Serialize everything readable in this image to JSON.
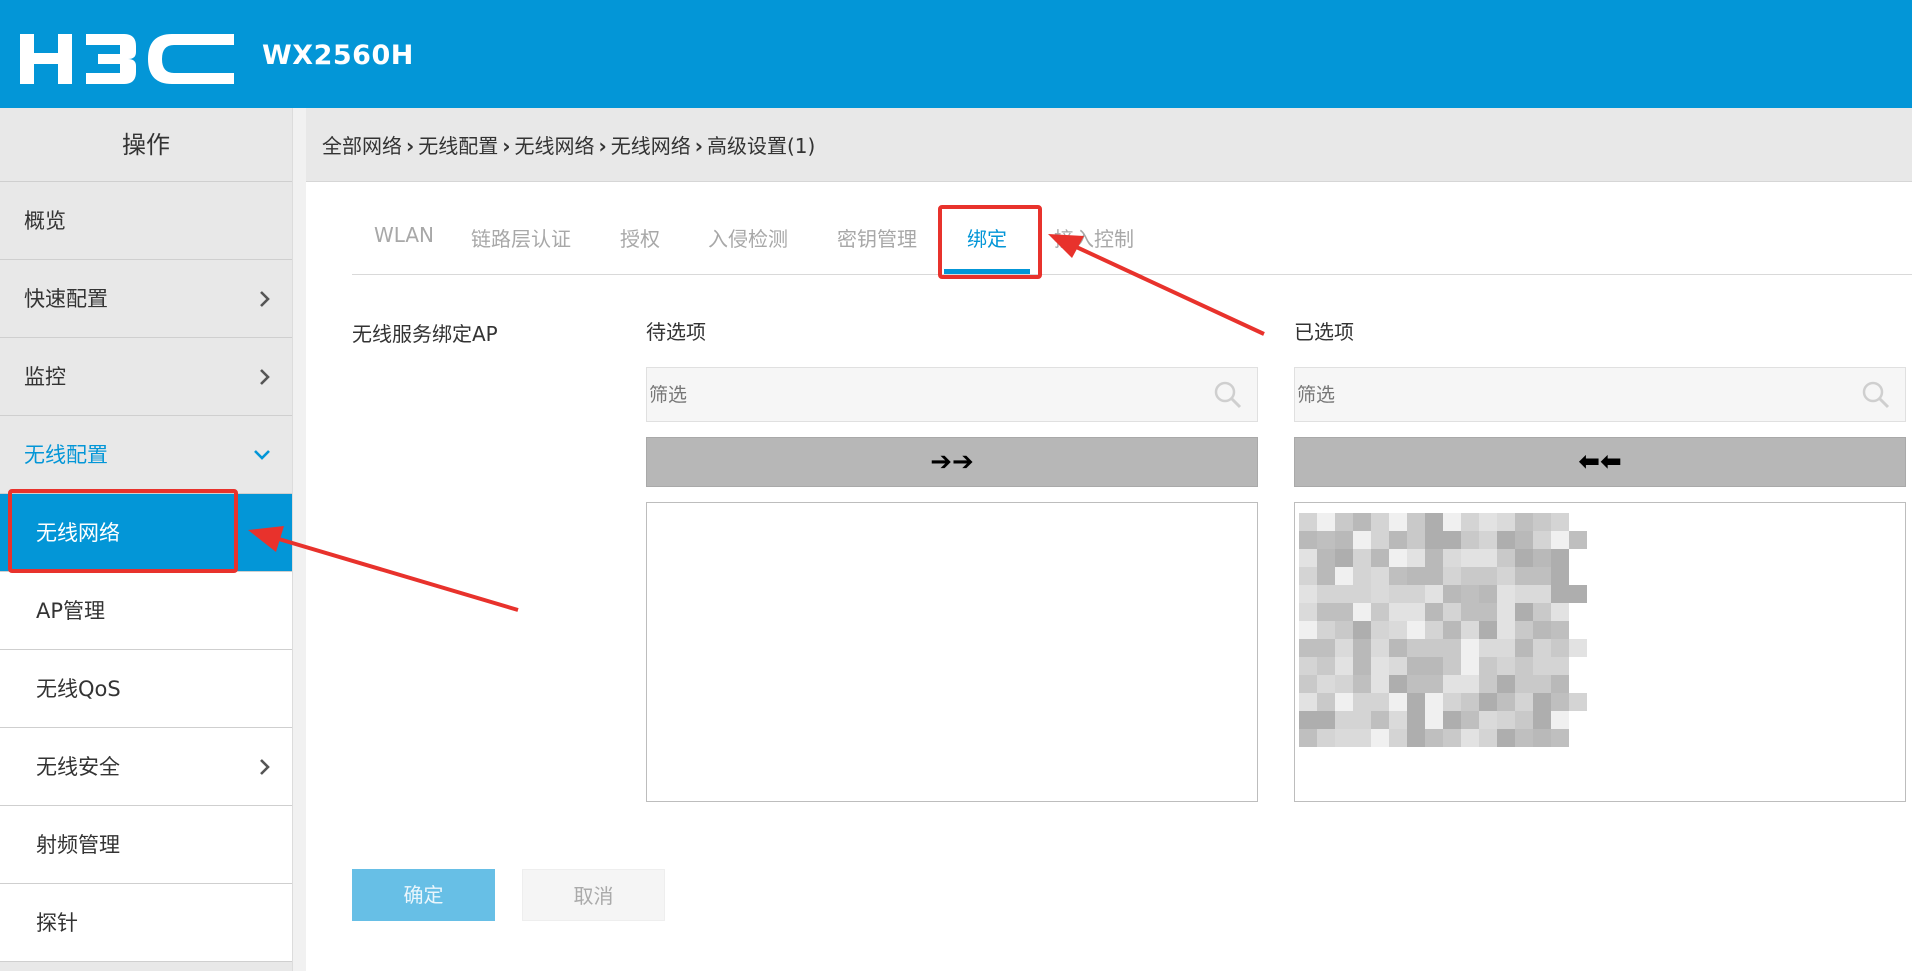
{
  "header": {
    "brand": "H3C",
    "model": "WX2560H",
    "bar_color": "#0396d7"
  },
  "sidebar": {
    "title": "操作",
    "items": [
      {
        "label": "概览",
        "chevron": "",
        "state": "normal"
      },
      {
        "label": "快速配置",
        "chevron": "›",
        "state": "normal"
      },
      {
        "label": "监控",
        "chevron": "›",
        "state": "normal"
      },
      {
        "label": "无线配置",
        "chevron": "⌄",
        "state": "expanded"
      },
      {
        "label": "无线网络",
        "chevron": "",
        "state": "active"
      },
      {
        "label": "AP管理",
        "chevron": "",
        "state": "sub"
      },
      {
        "label": "无线QoS",
        "chevron": "",
        "state": "sub"
      },
      {
        "label": "无线安全",
        "chevron": "›",
        "state": "sub"
      },
      {
        "label": "射频管理",
        "chevron": "",
        "state": "sub"
      },
      {
        "label": "探针",
        "chevron": "",
        "state": "sub"
      }
    ]
  },
  "breadcrumb": [
    "全部网络",
    "无线配置",
    "无线网络",
    "无线网络",
    "高级设置(1)"
  ],
  "tabs": [
    "WLAN",
    "链路层认证",
    "授权",
    "入侵检测",
    "密钥管理",
    "绑定",
    "接入控制"
  ],
  "active_tab": "绑定",
  "binding": {
    "label": "无线服务绑定AP",
    "available": {
      "title": "待选项",
      "filter_placeholder": "筛选",
      "move_label": "➔➔"
    },
    "selected": {
      "title": "已选项",
      "filter_placeholder": "筛选",
      "move_label": "⬅⬅"
    }
  },
  "actions": {
    "ok": "确定",
    "cancel": "取消"
  },
  "colors": {
    "accent": "#0396d7",
    "annotation": "#e8322c",
    "ok_button": "#67bfe6"
  }
}
